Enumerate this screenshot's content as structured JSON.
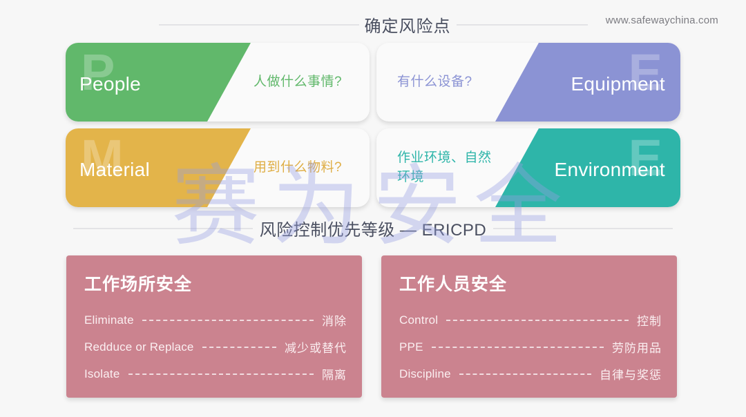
{
  "page": {
    "site_url": "www.safewaychina.com",
    "background_color": "#f7f7f7",
    "watermark_text": "赛为安全"
  },
  "section_one": {
    "title": "确定风险点",
    "cards": [
      {
        "key": "people",
        "letter": "P",
        "label": "People",
        "description": "人做什么事情?",
        "color": "#61b86b",
        "wedge_side": "left"
      },
      {
        "key": "equipment",
        "letter": "E",
        "label": "Equipment",
        "description": "有什么设备?",
        "color": "#8b93d4",
        "wedge_side": "right"
      },
      {
        "key": "material",
        "letter": "M",
        "label": "Material",
        "description": "用到什么物料?",
        "color": "#e3b44a",
        "wedge_side": "left"
      },
      {
        "key": "environment",
        "letter": "E",
        "label": "Environment",
        "description": "作业环境、自然\n环境",
        "color": "#2eb5a9",
        "wedge_side": "right"
      }
    ]
  },
  "section_two": {
    "title": "风险控制优先等级 — ERICPD",
    "cards": [
      {
        "key": "workplace",
        "title": "工作场所安全",
        "color": "#cb838f",
        "rows": [
          {
            "en": "Eliminate",
            "zh": "消除"
          },
          {
            "en": "Redduce or Replace",
            "zh": "减少或替代"
          },
          {
            "en": "Isolate",
            "zh": "隔离"
          }
        ]
      },
      {
        "key": "worker",
        "title": "工作人员安全",
        "color": "#cb838f",
        "rows": [
          {
            "en": "Control",
            "zh": "控制"
          },
          {
            "en": "PPE",
            "zh": "劳防用品"
          },
          {
            "en": "Discipline",
            "zh": "自律与奖惩"
          }
        ]
      }
    ]
  }
}
